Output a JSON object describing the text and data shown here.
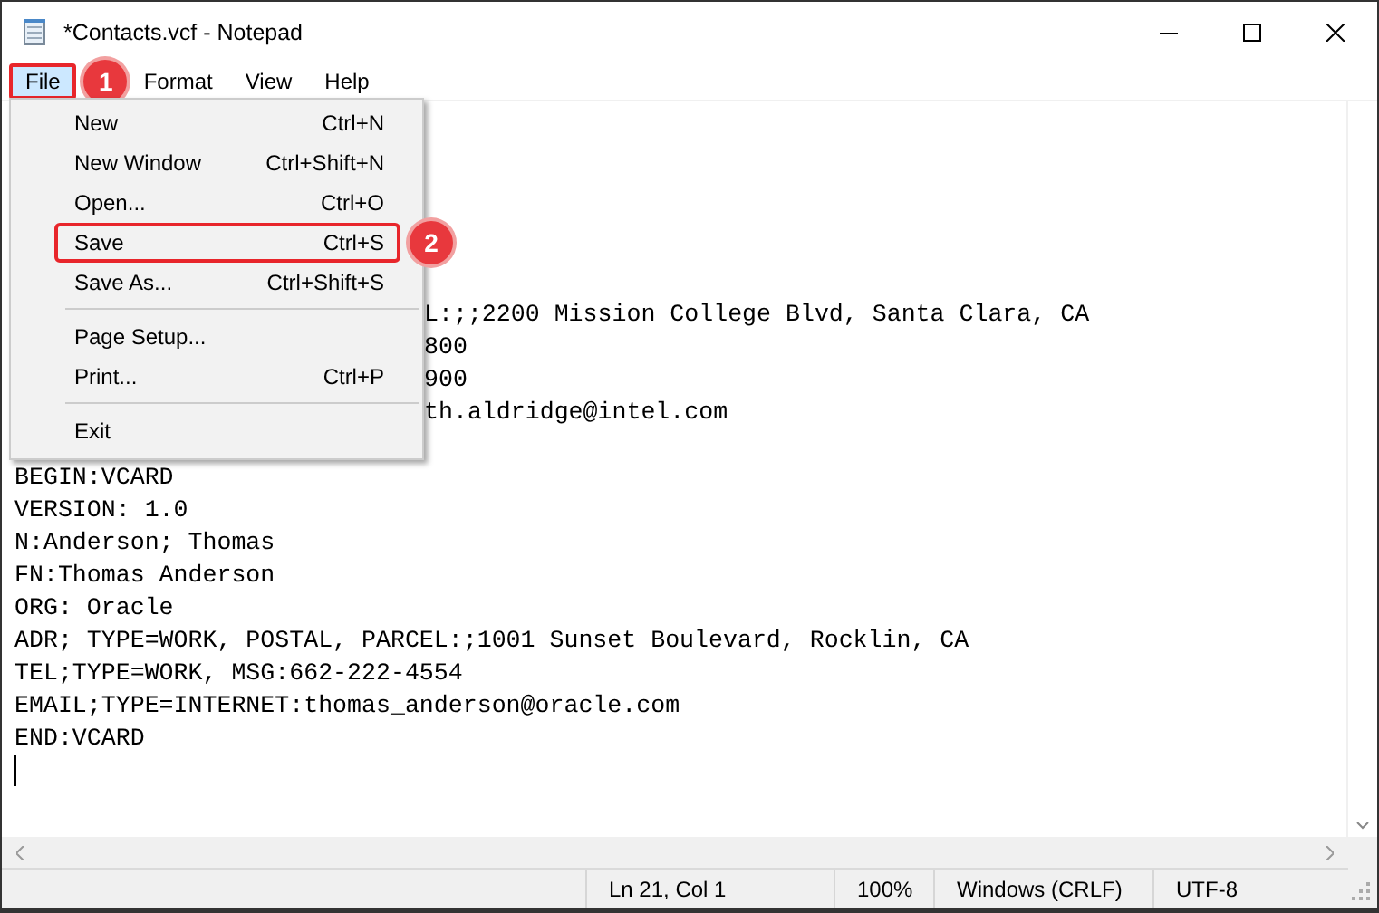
{
  "window": {
    "title": "*Contacts.vcf - Notepad"
  },
  "menu_bar": [
    {
      "label": "File",
      "selected": true,
      "marker": "1"
    },
    {
      "label": "Format",
      "selected": false
    },
    {
      "label": "View",
      "selected": false
    },
    {
      "label": "Help",
      "selected": false
    }
  ],
  "file_menu": {
    "items": [
      {
        "kind": "item",
        "label": "New",
        "shortcut": "Ctrl+N",
        "selected": false
      },
      {
        "kind": "item",
        "label": "New Window",
        "shortcut": "Ctrl+Shift+N",
        "selected": false
      },
      {
        "kind": "item",
        "label": "Open...",
        "shortcut": "Ctrl+O",
        "selected": false
      },
      {
        "kind": "item",
        "label": "Save",
        "shortcut": "Ctrl+S",
        "selected": false,
        "marker": "2"
      },
      {
        "kind": "item",
        "label": "Save As...",
        "shortcut": "Ctrl+Shift+S",
        "selected": false
      },
      {
        "kind": "separator"
      },
      {
        "kind": "item",
        "label": "Page Setup...",
        "selected": false
      },
      {
        "kind": "item",
        "label": "Print...",
        "shortcut": "Ctrl+P",
        "selected": false
      },
      {
        "kind": "separator"
      },
      {
        "kind": "item",
        "label": "Exit",
        "selected": false
      }
    ]
  },
  "editor": {
    "lines": [
      {
        "kind": "covered",
        "text": "L:;;2200 Mission College Blvd, Santa Clara, CA"
      },
      {
        "kind": "covered",
        "text": "800"
      },
      {
        "kind": "covered",
        "text": "900"
      },
      {
        "kind": "covered",
        "text": "th.aldridge@intel.com"
      },
      {
        "kind": "full",
        "text": "BEGIN:VCARD"
      },
      {
        "kind": "full",
        "text": "VERSION: 1.0"
      },
      {
        "kind": "full",
        "text": "N:Anderson; Thomas"
      },
      {
        "kind": "full",
        "text": "FN:Thomas Anderson"
      },
      {
        "kind": "full",
        "text": "ORG: Oracle"
      },
      {
        "kind": "full",
        "text": "ADR; TYPE=WORK, POSTAL, PARCEL:;1001 Sunset Boulevard, Rocklin, CA"
      },
      {
        "kind": "full",
        "text": "TEL;TYPE=WORK, MSG:662-222-4554"
      },
      {
        "kind": "full",
        "text": "EMAIL;TYPE=INTERNET:thomas_anderson@oracle.com"
      },
      {
        "kind": "full",
        "text": "END:VCARD"
      }
    ],
    "caret": true
  },
  "status_bar": {
    "position": "Ln 21, Col 1",
    "zoom": "100%",
    "line_ending": "Windows (CRLF)",
    "encoding": "UTF-8"
  }
}
